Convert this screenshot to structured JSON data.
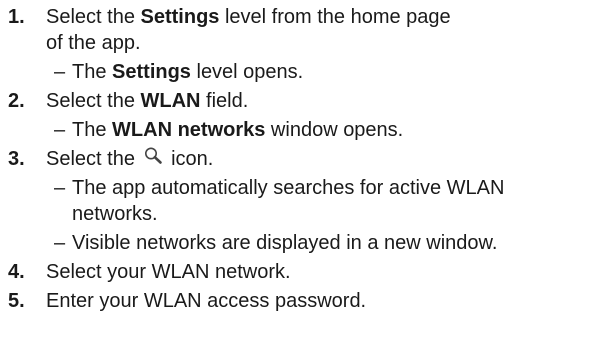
{
  "steps": [
    {
      "number": "1.",
      "before": "Select the ",
      "bold": "Settings",
      "after": " level from the home page",
      "line2": "of the app.",
      "results": [
        {
          "dash": "–",
          "before": "The ",
          "bold": "Settings",
          "after": " level opens."
        }
      ]
    },
    {
      "number": "2.",
      "before": "Select the ",
      "bold": "WLAN",
      "after": " field.",
      "results": [
        {
          "dash": "–",
          "before": "The ",
          "bold": "WLAN networks",
          "after": " window opens."
        }
      ]
    },
    {
      "number": "3.",
      "before": "Select the ",
      "icon": "search-icon",
      "after": " icon.",
      "results": [
        {
          "dash": "–",
          "line1": "The app automatically searches for active WLAN",
          "line2": "networks."
        },
        {
          "dash": "–",
          "text": "Visible networks are displayed in a new window."
        }
      ]
    },
    {
      "number": "4.",
      "text": "Select your WLAN network."
    },
    {
      "number": "5.",
      "text": "Enter your WLAN access password."
    }
  ],
  "colors": {
    "text": "#1a1a1a",
    "icon": "#444444"
  }
}
